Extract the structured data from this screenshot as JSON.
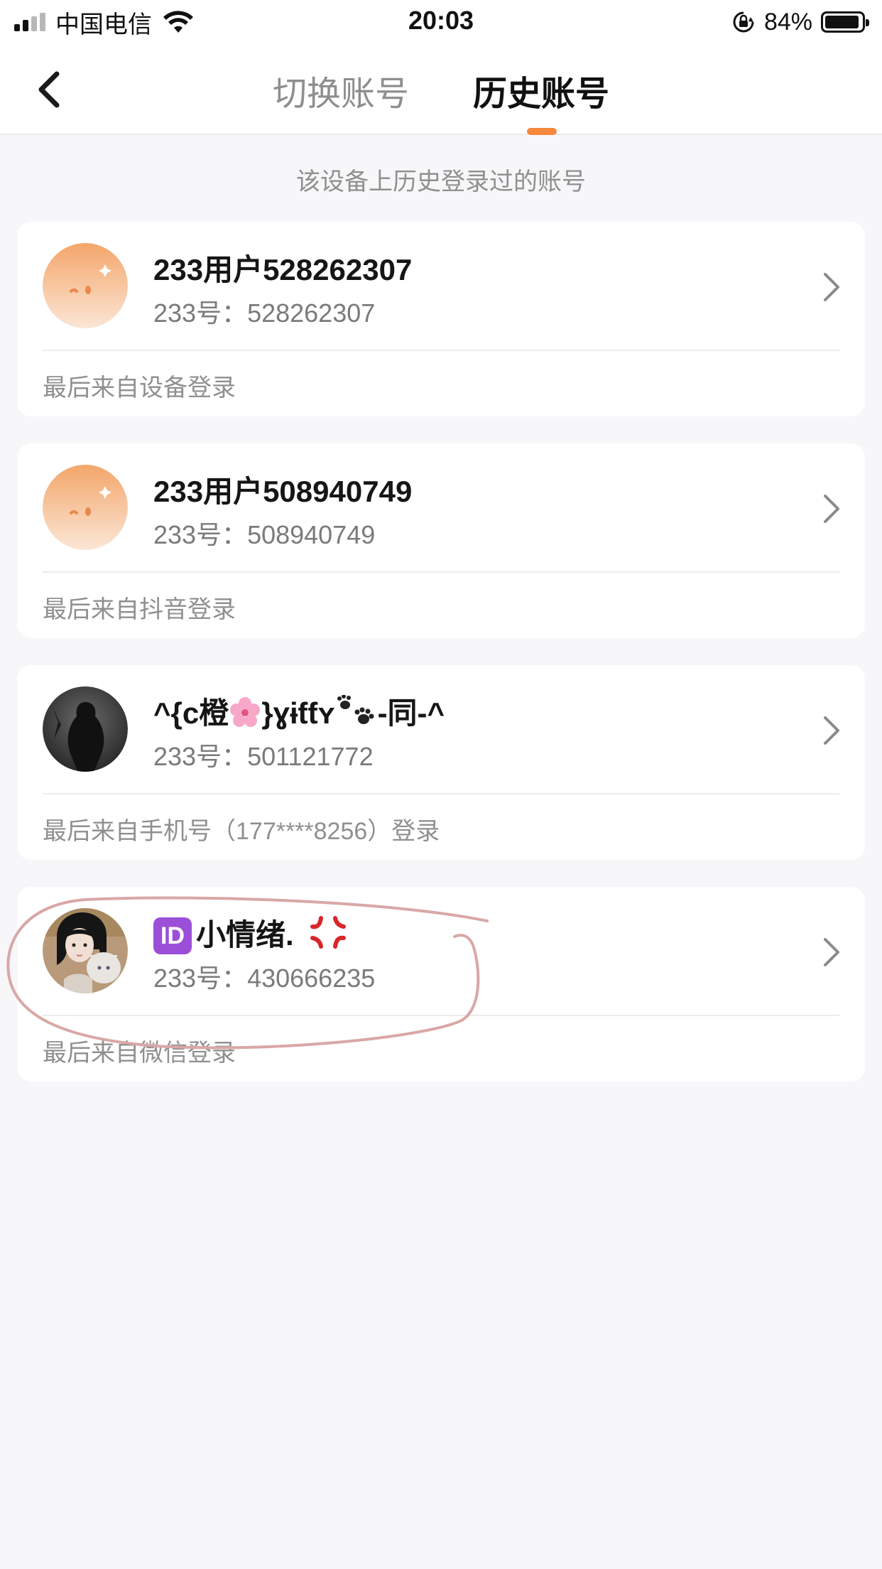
{
  "status_bar": {
    "carrier": "中国电信",
    "time": "20:03",
    "battery": "84%",
    "battery_level": 0.84,
    "signal_bars": 2
  },
  "nav": {
    "back_icon": "chevron-left-icon",
    "tabs": [
      {
        "label": "切换账号",
        "active": false
      },
      {
        "label": "历史账号",
        "active": true
      }
    ],
    "accent_color": "#f5883d"
  },
  "hint": "该设备上历史登录过的账号",
  "accounts": [
    {
      "name": "233用户528262307",
      "id_label": "233号：",
      "id": "528262307",
      "source": "最后来自设备登录",
      "avatar": "orange-mascot-avatar"
    },
    {
      "name": "233用户508940749",
      "id_label": "233号：",
      "id": "508940749",
      "source": "最后来自抖音登录",
      "avatar": "orange-mascot-avatar"
    },
    {
      "name_prefix": "^{c橙",
      "name_middle": "}ɣɨƭƭʏ",
      "name_suffix": "-同-^",
      "id_label": "233号：",
      "id": "501121772",
      "source": "最后来自手机号（177****8256）登录",
      "avatar": "dark-silhouette-avatar"
    },
    {
      "name_badge": "ID",
      "name": "小情绪.",
      "id_label": "233号：",
      "id": "430666235",
      "source": "最后来自微信登录",
      "avatar": "girl-with-cat-avatar"
    }
  ],
  "annotation_color": "#d9a7a7"
}
